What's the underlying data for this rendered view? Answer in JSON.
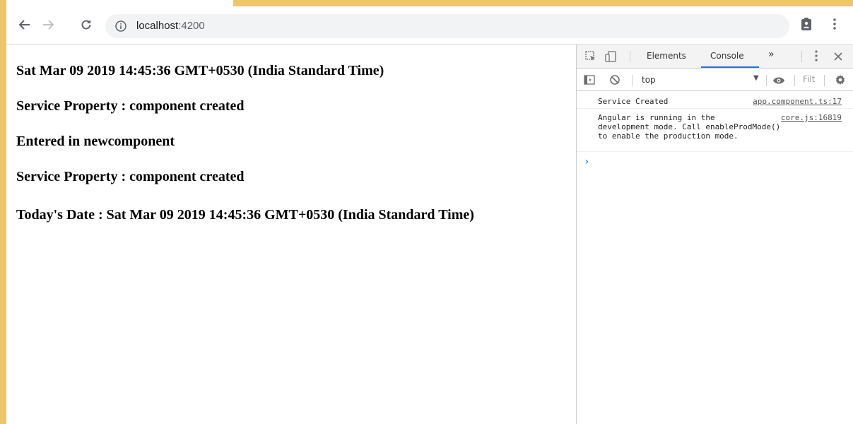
{
  "browser": {
    "url_host": "localhost",
    "url_port": ":4200"
  },
  "page": {
    "lines": [
      "Sat Mar 09 2019 14:45:36 GMT+0530 (India Standard Time)",
      "Service Property : component created",
      "Entered in newcomponent",
      "Service Property : component created",
      "Today's Date : Sat Mar 09 2019 14:45:36 GMT+0530 (India Standard Time)"
    ]
  },
  "devtools": {
    "tabs": {
      "elements": "Elements",
      "console": "Console",
      "more": "»"
    },
    "context": "top",
    "filter_placeholder": "Filt",
    "messages": [
      {
        "text": "Service Created",
        "source": "app.component.ts:17"
      },
      {
        "text": "Angular is running in the\ndevelopment mode. Call enableProdMode()\nto enable the production mode.",
        "source": "core.js:16819"
      }
    ],
    "prompt_symbol": "›"
  },
  "colors": {
    "frame": "#f0c46b",
    "accent": "#1a73e8"
  }
}
